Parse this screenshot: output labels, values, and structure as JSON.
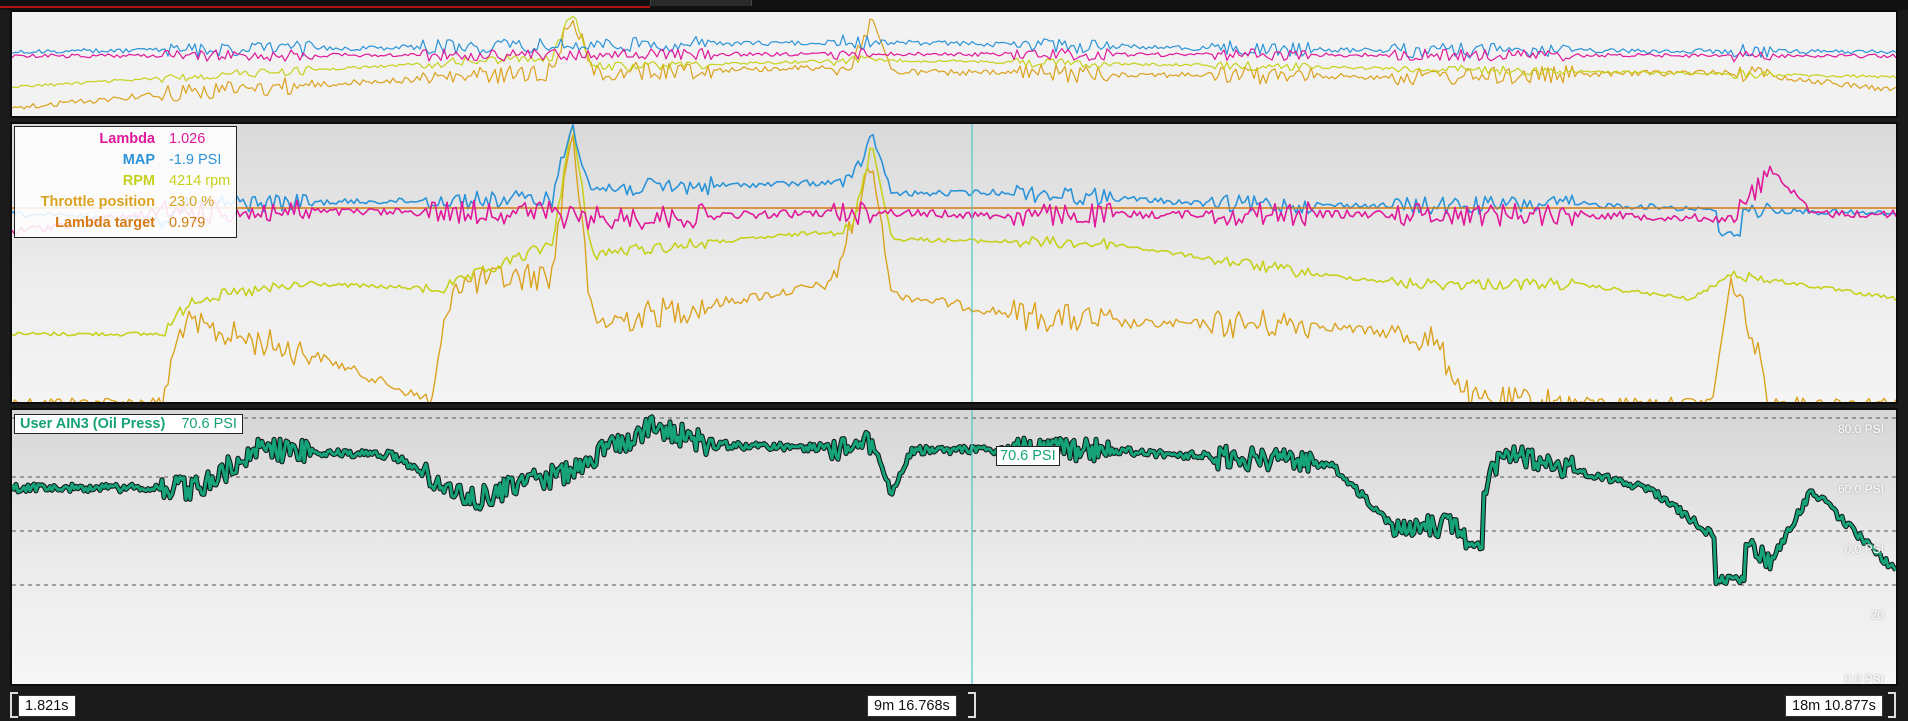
{
  "colors": {
    "lambda": "#e0189a",
    "map": "#2b93d8",
    "rpm": "#c6d11d",
    "throttle": "#dba21e",
    "lambda_target": "#d57a12",
    "oil": "#16a37a",
    "cursor": "#4ec7c2"
  },
  "legend": [
    {
      "name": "Lambda",
      "value": "1.026",
      "color": "#e0189a"
    },
    {
      "name": "MAP",
      "value": "-1.9 PSI",
      "color": "#2b93d8"
    },
    {
      "name": "RPM",
      "value": "4214 rpm",
      "color": "#c6d11d"
    },
    {
      "name": "Throttle position",
      "value": "23.0 %",
      "color": "#dba21e"
    },
    {
      "name": "Lambda target",
      "value": "0.979",
      "color": "#d57a12"
    }
  ],
  "oil_panel": {
    "channel_name": "User AIN3 (Oil Press)",
    "value": "70.6 PSI",
    "cursor_value": "70.6 PSI",
    "y_tick_labels": [
      "80.0 PSI",
      "60.0 PSI",
      "0.0 PSI",
      "20",
      "0.0 PSI"
    ]
  },
  "time_axis": {
    "start": "1.821s",
    "cursor": "9m 16.768s",
    "end": "18m 10.877s"
  }
}
